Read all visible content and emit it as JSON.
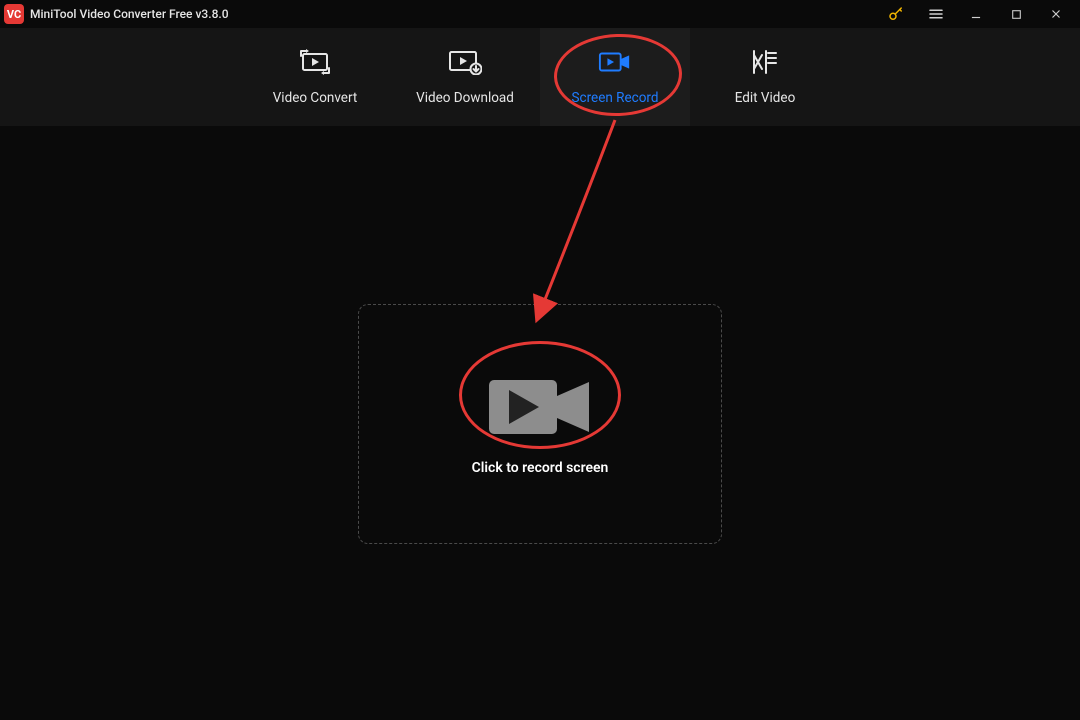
{
  "app": {
    "title": "MiniTool Video Converter Free v3.8.0",
    "logo_text": "VC"
  },
  "titlebar": {
    "key": "key-icon",
    "menu": "menu-icon",
    "minimize": "minimize-icon",
    "maximize": "maximize-icon",
    "close": "close-icon"
  },
  "tabs": [
    {
      "label": "Video Convert",
      "icon": "convert-icon",
      "active": false
    },
    {
      "label": "Video Download",
      "icon": "download-icon",
      "active": false
    },
    {
      "label": "Screen Record",
      "icon": "record-icon",
      "active": true
    },
    {
      "label": "Edit Video",
      "icon": "edit-icon",
      "active": false
    }
  ],
  "main": {
    "record_button_label": "Click to record screen"
  },
  "annotations": {
    "tab_highlight": "Screen Record",
    "arrow_from": "tab",
    "arrow_to": "record-button"
  },
  "colors": {
    "accent": "#1f7cff",
    "annotation": "#e53935",
    "bg": "#0a0a0a",
    "header": "#151515"
  }
}
